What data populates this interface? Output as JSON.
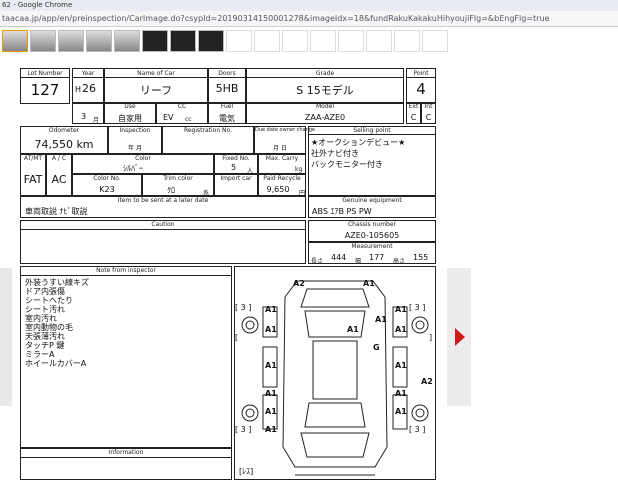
{
  "window": {
    "title": "62 - Google Chrome"
  },
  "address_bar": {
    "url": "taacaa.jp/app/en/preinspection/CarImage.do?csypId=20190314150001278&imageIdx=18&fundRakuKakakuHihyoujiFlg=&bEngFlg=true"
  },
  "sheet": {
    "labels": {
      "lot_number": "Lot Number",
      "year": "Year",
      "name_of_car": "Name of Car",
      "doors": "Doors",
      "grade": "Grade",
      "point": "Point",
      "use": "Use",
      "cc": "CC",
      "fuel": "Fuel",
      "model": "Model",
      "ext": "Ext",
      "int": "Int",
      "odometer": "Odometer",
      "inspection": "Inspection",
      "registration_no": "Registration No.",
      "due_date": "Due date owner change",
      "selling_point": "Selling point",
      "at_mt": "AT/MT",
      "ac": "A / C",
      "color": "Color",
      "fixed_no": "Fixed No.",
      "max_carry": "Max. Carry",
      "color_no": "Color No.",
      "trim_color": "Trim color",
      "import_car": "Import car",
      "paid_recycle": "Paid Recycle",
      "sent_later": "Item to be sent at a later date",
      "genuine_equipment": "Genuine equipment",
      "caution": "Caution",
      "chassis_number": "Chassis number",
      "measurement": "Measurement",
      "note_from_inspector": "Note from inspector",
      "information": "Information"
    },
    "lot_number": "127",
    "era_mark": "H",
    "year": "26",
    "name_of_car": "リーフ",
    "doors": "5HB",
    "grade": "S 15モデル",
    "point": "4",
    "month": "3",
    "month_unit": "月",
    "use": "自家用",
    "cc": "EV",
    "cc_unit": "cc",
    "fuel": "電気",
    "model": "ZAA-AZE0",
    "ext": "C",
    "int": "C",
    "odometer": "74,550 km",
    "inspection_unit": "年 月",
    "due_date_unit": "月 日",
    "selling_points": [
      "★オークションデビュー★",
      "社外ナビ付き",
      "バックモニター付き"
    ],
    "transmission": "FAT",
    "ac": "AC",
    "color": "ｼﾙﾊﾞｰ",
    "seats": "5",
    "seats_unit": "人",
    "kg": "kg",
    "color_no": "K23",
    "trim_color": "ｸﾛ",
    "trim_unit": "系",
    "yen": "円",
    "paid_recycle": "9,650",
    "sent_later": "車両取説 ﾅﾋﾞ取説",
    "genuine_equipment": "ABS ｴｱB PS PW",
    "chassis_number": "AZE0-105605",
    "measurement": {
      "length_label": "長さ",
      "length": "444",
      "width_label": "幅",
      "width": "177",
      "height_label": "高さ",
      "height": "155"
    },
    "inspector_notes": [
      "外装うすい線キズ",
      "ドア内張傷",
      "シートへたり",
      "シート汚れ",
      "室内汚れ",
      "室内動物の毛",
      "天張薄汚れ",
      "タッチP 鍵",
      "ミラーA",
      "ホイールカバーA"
    ],
    "diagram": {
      "marks": [
        "A2",
        "A1",
        "A1",
        "A1",
        "A1",
        "A1",
        "A1",
        "A1",
        "G",
        "A1",
        "A1",
        "A2",
        "A1",
        "A1",
        "A1",
        "A1",
        "A1"
      ],
      "bracket_3": "[ 3 ]",
      "bracket_left": "[",
      "bracket_right": "]",
      "reverse_label": "[ﾚｽ]"
    }
  }
}
